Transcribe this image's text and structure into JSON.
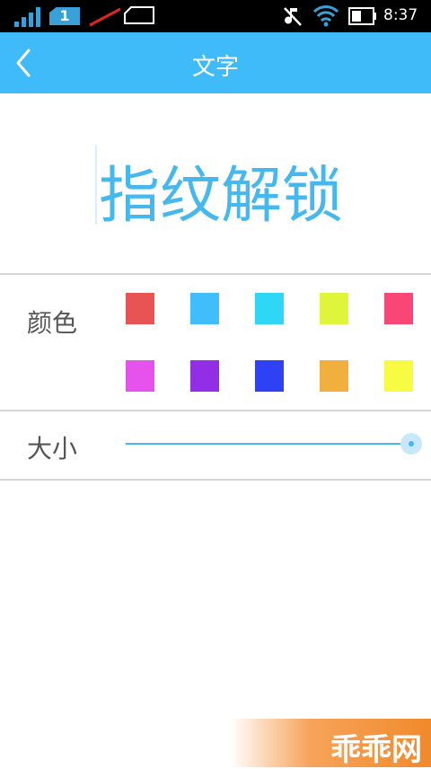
{
  "status_bar": {
    "sim_slot": "1",
    "time": "8:37",
    "icons": [
      "signal-icon",
      "sim-icon",
      "no-data-icon",
      "notification-icon",
      "mute-icon",
      "wifi-icon",
      "battery-icon"
    ]
  },
  "header": {
    "title": "文字",
    "back_icon": "chevron-left-icon",
    "background": "#40bbf9"
  },
  "preview": {
    "text": "指纹解锁",
    "text_color": "#45b8ee"
  },
  "color_section": {
    "label": "颜色",
    "swatches": [
      {
        "name": "red",
        "color": "#e85454"
      },
      {
        "name": "sky-blue",
        "color": "#40bdfb"
      },
      {
        "name": "cyan",
        "color": "#2ed7f5"
      },
      {
        "name": "lime",
        "color": "#dff53c"
      },
      {
        "name": "pink",
        "color": "#f84776"
      },
      {
        "name": "magenta",
        "color": "#e653ec"
      },
      {
        "name": "purple",
        "color": "#922ee6"
      },
      {
        "name": "blue",
        "color": "#2f41f4"
      },
      {
        "name": "orange",
        "color": "#f1b03d"
      },
      {
        "name": "yellow",
        "color": "#f7fb42"
      }
    ]
  },
  "size_section": {
    "label": "大小",
    "slider_value": 1.0
  },
  "watermark": {
    "text": "乖乖网"
  }
}
